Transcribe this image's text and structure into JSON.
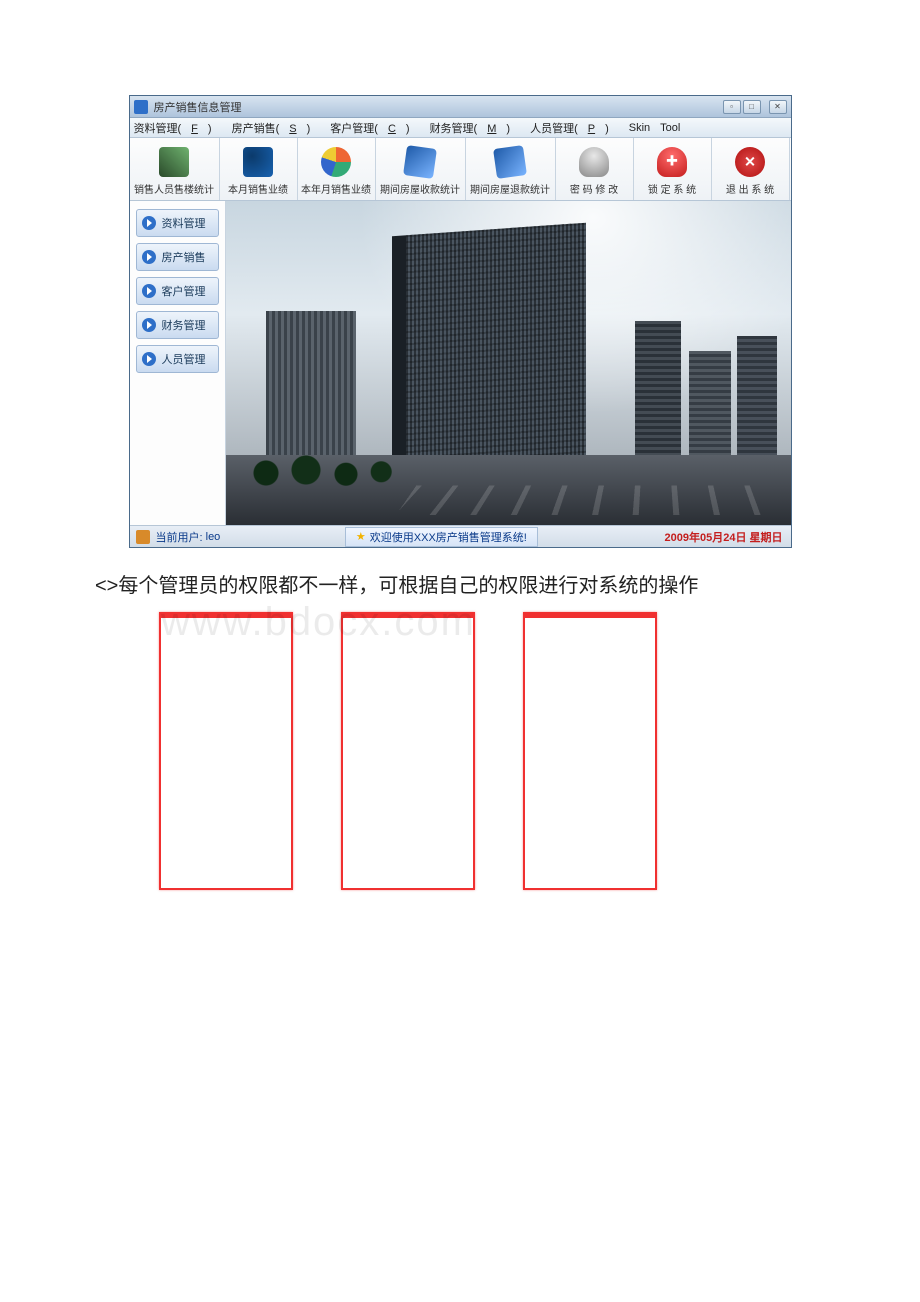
{
  "window": {
    "title": "房产销售信息管理"
  },
  "menubar": {
    "items": [
      {
        "label": "资料管理(",
        "shortcut": "F",
        "tail": ")"
      },
      {
        "label": "房产销售(",
        "shortcut": "S",
        "tail": ")"
      },
      {
        "label": "客户管理(",
        "shortcut": "C",
        "tail": ")"
      },
      {
        "label": "财务管理(",
        "shortcut": "M",
        "tail": ")"
      },
      {
        "label": "人员管理(",
        "shortcut": "P",
        "tail": ")"
      },
      {
        "label": "Skin",
        "shortcut": "",
        "tail": ""
      },
      {
        "label": "Tool",
        "shortcut": "",
        "tail": ""
      }
    ]
  },
  "toolbar": {
    "items": [
      {
        "label": "销售人员售楼统计",
        "icon": "chart"
      },
      {
        "label": "本月销售业绩",
        "icon": "pie1"
      },
      {
        "label": "本年月销售业绩",
        "icon": "pie2"
      },
      {
        "label": "期间房屋收款统计",
        "icon": "cube1"
      },
      {
        "label": "期间房屋退款统计",
        "icon": "cube2"
      },
      {
        "label": "密 码 修 改",
        "icon": "keys"
      },
      {
        "label": "锁 定 系 统",
        "icon": "shield"
      },
      {
        "label": "退 出 系 统",
        "icon": "exit"
      }
    ]
  },
  "sidebar": {
    "items": [
      "资料管理",
      "房产销售",
      "客户管理",
      "财务管理",
      "人员管理"
    ]
  },
  "statusbar": {
    "user_label": "当前用户:",
    "user_value": "leo",
    "welcome": "欢迎使用XXX房产销售管理系统!",
    "date": "2009年05月24日 星期日"
  },
  "body_text": "<>每个管理员的权限都不一样，可根据自己的权限进行对系统的操作",
  "watermark": "www.bdocx.com"
}
